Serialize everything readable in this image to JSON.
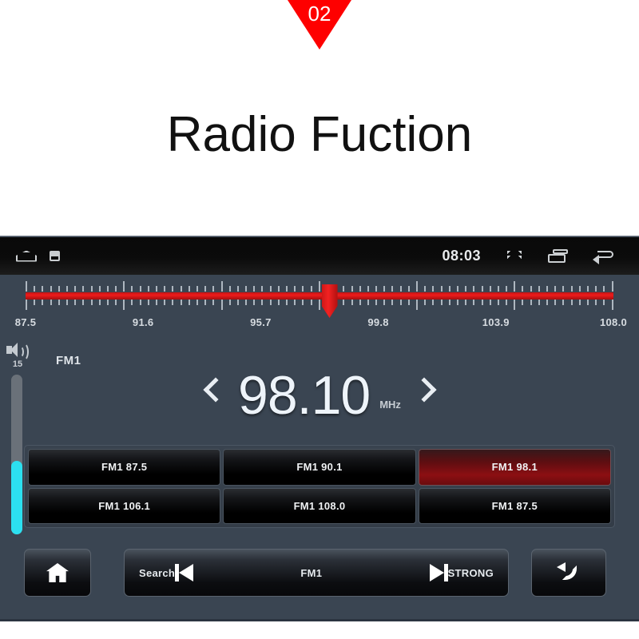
{
  "banner": {
    "badge_number": "02",
    "title": "Radio Fuction"
  },
  "device": {
    "statusbar": {
      "home_icon": "home-outline-icon",
      "notification_icon": "notification-icon",
      "time": "08:03",
      "chevron_up_icon": "chevron-up-icon",
      "recents_icon": "recents-icon",
      "back_icon": "back-arrow-icon"
    },
    "tuning_scale": {
      "labels": [
        "87.5",
        "91.6",
        "95.7",
        "99.8",
        "103.9",
        "108.0"
      ],
      "min": 87.5,
      "max": 108.0,
      "marker_value": 98.1,
      "bar_color": "#ee1b1b",
      "marker_color": "#f22222"
    },
    "volume": {
      "speaker_icon": "speaker-icon",
      "level": "15",
      "fill_percent": 46,
      "fill_color": "#2ce0f0"
    },
    "band": {
      "label": "FM1"
    },
    "frequency": {
      "prev_icon": "chevron-left-icon",
      "value": "98.10",
      "unit": "MHz",
      "next_icon": "chevron-right-icon"
    },
    "presets": [
      {
        "label": "FM1 87.5",
        "active": false
      },
      {
        "label": "FM1 90.1",
        "active": false
      },
      {
        "label": "FM1 98.1",
        "active": true
      },
      {
        "label": "FM1 106.1",
        "active": false
      },
      {
        "label": "FM1 108.0",
        "active": false
      },
      {
        "label": "FM1 87.5",
        "active": false
      }
    ],
    "active_preset_color": "#8c0f12",
    "bottom_bar": {
      "home_icon": "home-solid-icon",
      "search_label": "Search",
      "prev_icon": "previous-track-icon",
      "band_label": "FM1",
      "next_icon": "next-track-icon",
      "signal_label": "STRONG",
      "return_icon": "return-arrow-icon"
    },
    "background_color": "#3a4552"
  }
}
